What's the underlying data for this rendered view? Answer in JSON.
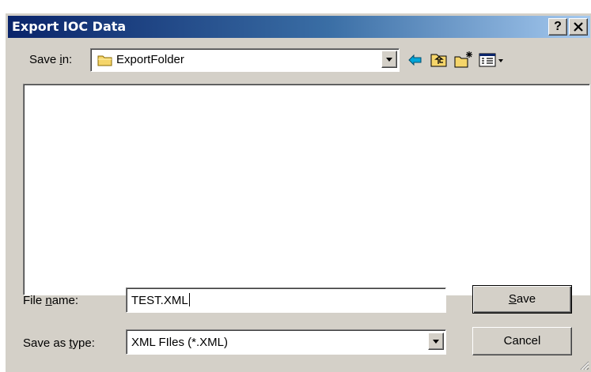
{
  "window": {
    "title": "Export IOC Data",
    "help_label": "?",
    "close_label": "x"
  },
  "save_in": {
    "label": "Save in:",
    "value": "ExportFolder"
  },
  "toolbar": {
    "icons": [
      "back-icon",
      "up-folder-icon",
      "new-folder-icon",
      "view-menu-icon"
    ]
  },
  "file_list": {
    "items": []
  },
  "file_name": {
    "label": "File name:",
    "value": "TEST.XML"
  },
  "save_as_type": {
    "label": "Save as type:",
    "value": "XML FIles (*.XML)"
  },
  "buttons": {
    "save": "Save",
    "cancel": "Cancel"
  },
  "colors": {
    "face": "#d4d0c8",
    "title_start": "#0a246a",
    "title_end": "#a6caf0",
    "back_arrow": "#00a6d9"
  }
}
